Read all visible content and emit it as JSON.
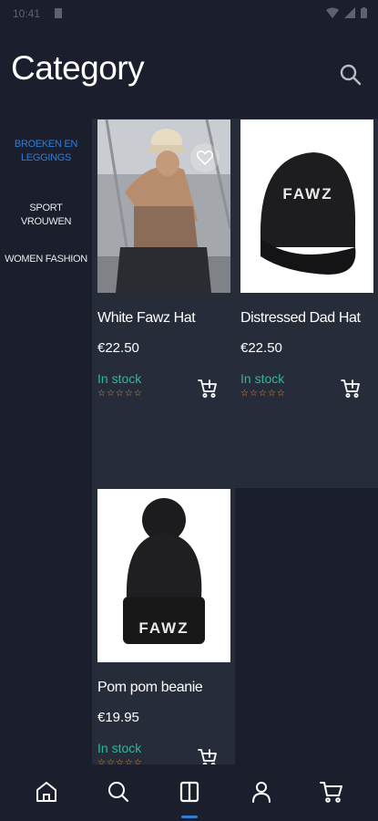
{
  "status_bar": {
    "time": "10:41"
  },
  "header": {
    "title": "Category"
  },
  "sidebar": {
    "items": [
      {
        "label": "BROEKEN EN LEGGINGS",
        "active": true
      },
      {
        "label": "SPORT VROUWEN",
        "active": false
      },
      {
        "label": "WOMEN FASHION",
        "active": false
      }
    ]
  },
  "products": [
    {
      "name": "White Fawz Hat",
      "price": "€22.50",
      "stock": "In stock",
      "stars": "☆☆☆☆☆"
    },
    {
      "name": "Distressed Dad Hat",
      "price": "€22.50",
      "stock": "In stock",
      "stars": "☆☆☆☆☆",
      "logo": "FAWZ"
    },
    {
      "name": "Pom pom beanie",
      "price": "€19.95",
      "stock": "In stock",
      "stars": "☆☆☆☆☆",
      "logo": "FAWZ"
    }
  ],
  "bottom_nav": {
    "items": [
      "home-icon",
      "search-icon",
      "categories-icon",
      "profile-icon",
      "cart-icon"
    ],
    "active": "categories-icon"
  },
  "colors": {
    "background": "#1b1f2d",
    "card": "#272c3b",
    "accent": "#2f7dd6",
    "in_stock": "#2fb79a",
    "stars": "#e0902a"
  }
}
